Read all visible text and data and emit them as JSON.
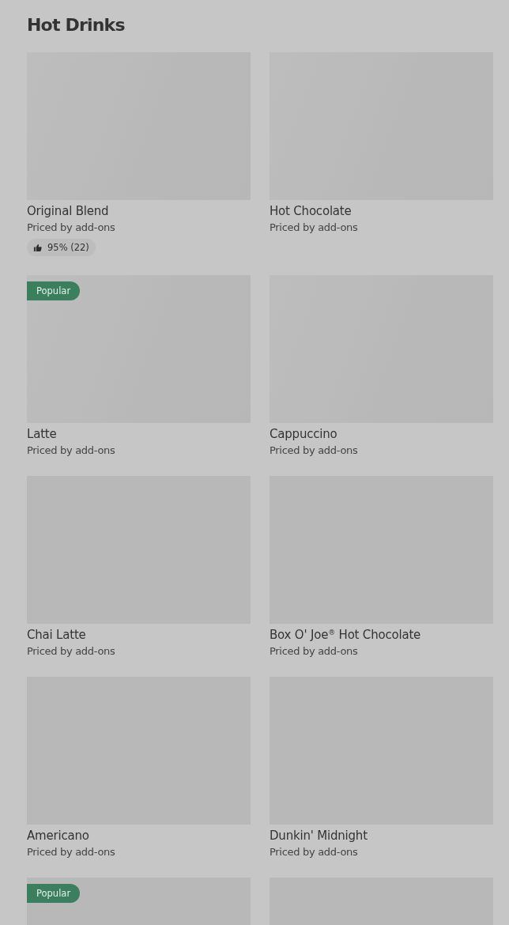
{
  "section": {
    "title": "Hot Drinks"
  },
  "items": [
    {
      "kind": "card",
      "name": "Original Blend",
      "subtitle": "Priced by add-ons",
      "rating": "95% (22)"
    },
    {
      "kind": "card",
      "name": "Hot Chocolate",
      "subtitle": "Priced by add-ons"
    },
    {
      "kind": "card",
      "name": "Latte",
      "subtitle": "Priced by add-ons",
      "badge": "Popular"
    },
    {
      "kind": "card",
      "name": "Cappuccino",
      "subtitle": "Priced by add-ons"
    },
    {
      "kind": "card",
      "name": "Chai Latte",
      "subtitle": "Priced by add-ons"
    },
    {
      "kind": "card",
      "name": "Box O' Joe$^{®}$ Hot Chocolate",
      "subtitle": "Priced by add-ons"
    },
    {
      "kind": "card",
      "name": "Americano",
      "subtitle": "Priced by add-ons"
    },
    {
      "kind": "card",
      "name": "Dunkin' Midnight",
      "subtitle": "Priced by add-ons"
    },
    {
      "kind": "card",
      "badge": "Popular"
    },
    {
      "kind": "card"
    }
  ]
}
